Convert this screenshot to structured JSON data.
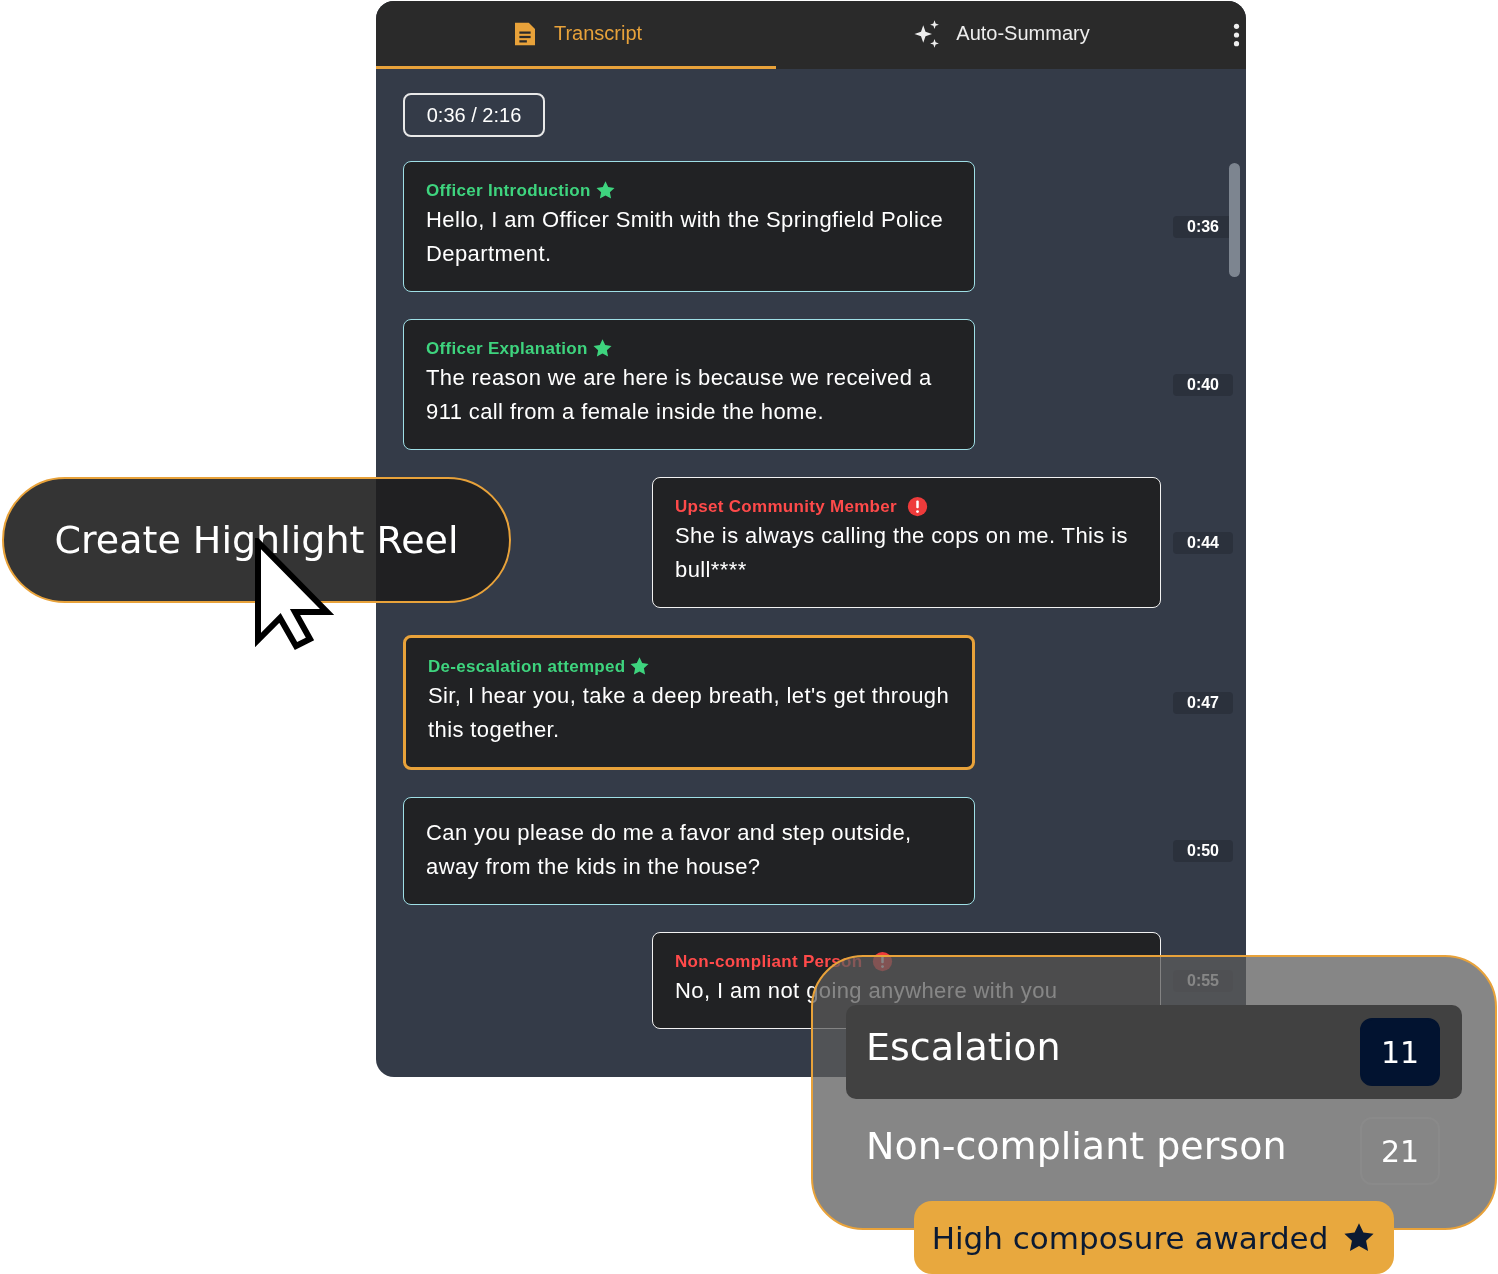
{
  "tabs": [
    {
      "label": "Transcript",
      "selected": true
    },
    {
      "label": "Auto-Summary",
      "selected": false
    }
  ],
  "playback": {
    "position": "0:36 / 2:16"
  },
  "messages": [
    {
      "label": "Officer Introduction",
      "kind": "officer",
      "text": "Hello, I am Officer Smith with the Springfield Police Department.",
      "time": "0:36",
      "highlighted": false
    },
    {
      "label": "Officer Explanation",
      "kind": "officer",
      "text": "The reason we are here is because we received a 911 call from a female inside the home.",
      "time": "0:40",
      "highlighted": false
    },
    {
      "label": "Upset Community Member",
      "kind": "civilian",
      "text": "She is always calling the cops on me. This is bull****",
      "time": "0:44",
      "highlighted": false
    },
    {
      "label": "De-escalation attemped",
      "kind": "officer",
      "text": "Sir, I hear you, take a deep breath, let's get through this together.",
      "time": "0:47",
      "highlighted": true
    },
    {
      "kind": "officer",
      "text": "Can you please do me a favor and step outside, away from the kids in the house?",
      "time": "0:50",
      "highlighted": false
    },
    {
      "label": "Non-compliant Person",
      "kind": "civilian",
      "text": "No,  I am not going anywhere with you",
      "time": "0:55",
      "highlighted": false
    }
  ],
  "highlight_button": {
    "label": "Create Highlight Reel"
  },
  "stats": {
    "items": [
      {
        "label": "Escalation",
        "count": "11",
        "selected": true
      },
      {
        "label": "Non-compliant person",
        "count": "21",
        "selected": false
      }
    ],
    "award": {
      "label": "High composure awarded"
    }
  }
}
